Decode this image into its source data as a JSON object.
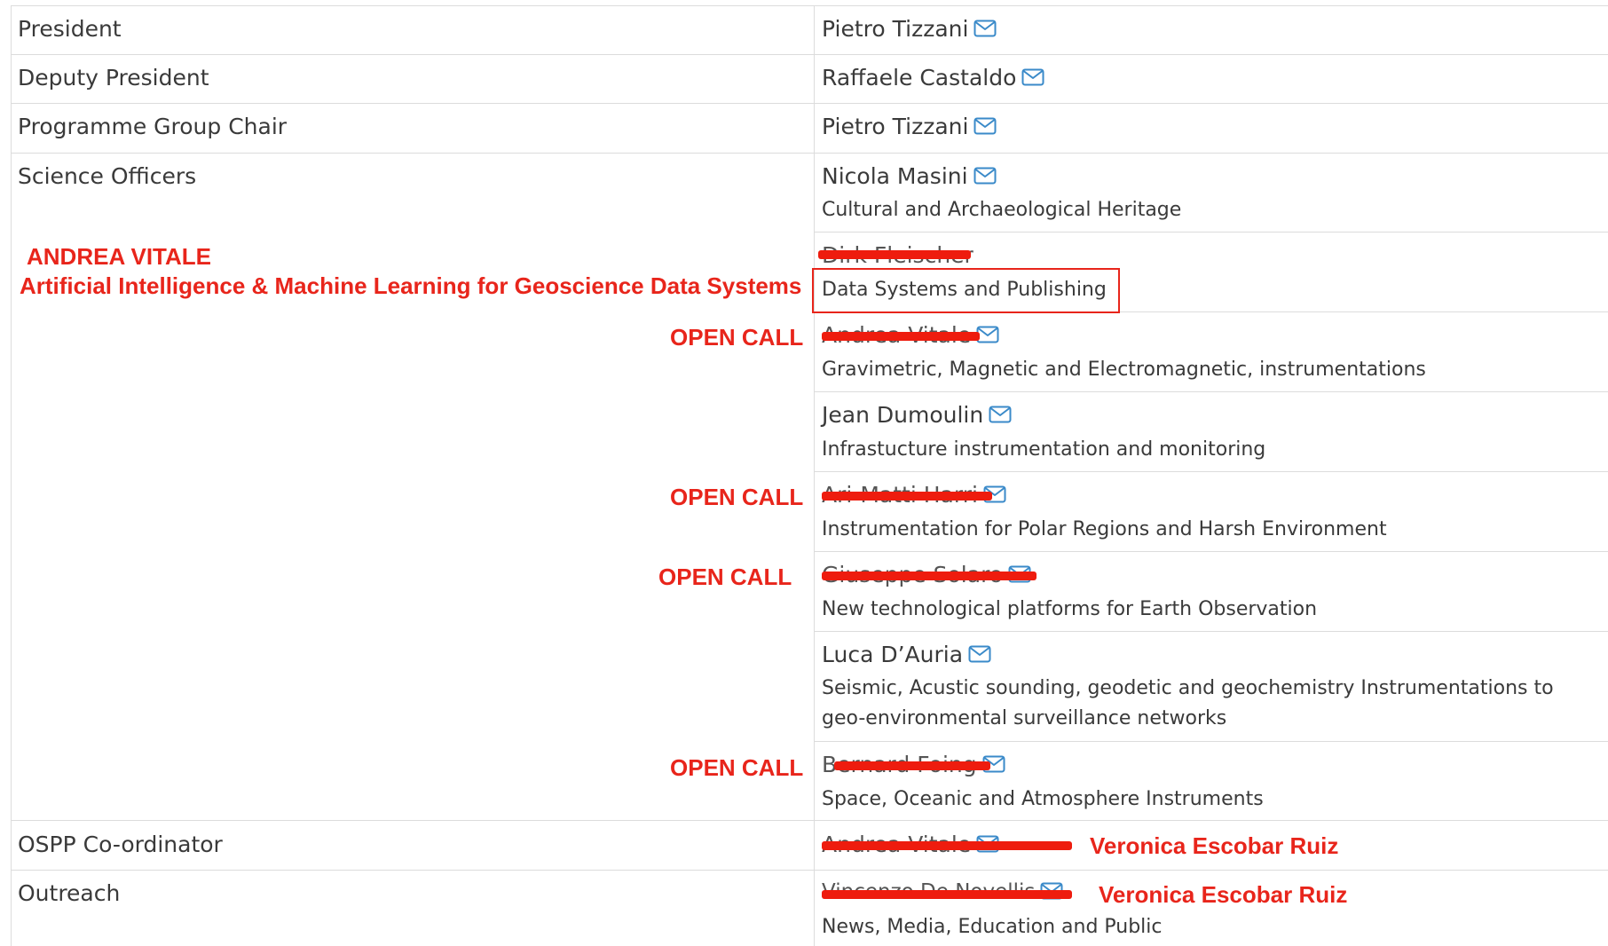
{
  "rows": {
    "president": {
      "role": "President",
      "person": "Pietro Tizzani"
    },
    "deputy": {
      "role": "Deputy President",
      "person": "Raffaele Castaldo"
    },
    "pg_chair": {
      "role": "Programme Group Chair",
      "person": "Pietro Tizzani"
    },
    "science": {
      "role": "Science Officers",
      "officers": [
        {
          "person": "Nicola Masini",
          "area": "Cultural and Archaeological Heritage"
        },
        {
          "person": "Dirk Fleischer",
          "area": "Data Systems and Publishing"
        },
        {
          "person": "Andrea Vitale",
          "area": "Gravimetric, Magnetic and Electromagnetic, instrumentations"
        },
        {
          "person": "Jean Dumoulin",
          "area": "Infrastucture instrumentation and monitoring"
        },
        {
          "person": "Ari-Matti Harri",
          "area": "Instrumentation for Polar Regions and Harsh Environment"
        },
        {
          "person": "Giuseppe Solaro",
          "area": "New technological platforms for Earth Observation"
        },
        {
          "person": "Luca D’Auria",
          "area": "Seismic, Acustic sounding, geodetic and geochemistry Instrumentations to geo-environmental surveillance networks"
        },
        {
          "person": "Bernard Foing",
          "area": "Space, Oceanic and Atmosphere Instruments"
        }
      ]
    },
    "ospp": {
      "role": "OSPP Co-ordinator",
      "person": "Andrea Vitale"
    },
    "outreach": {
      "role": "Outreach",
      "person": "Vincenzo De Novellis",
      "area": "News, Media, Education and Public"
    }
  },
  "annotations": {
    "name": "ANDREA VITALE",
    "topic": "Artificial Intelligence & Machine Learning for Geoscience Data Systems",
    "open_call_1": "OPEN CALL",
    "open_call_2": "OPEN CALL",
    "open_call_3": "OPEN CALL",
    "open_call_4": "OPEN CALL",
    "ospp_replacement": "Veronica Escobar Ruiz",
    "outreach_replacement": "Veronica Escobar Ruiz"
  },
  "colors": {
    "annotation_red": "#e8251b",
    "mail_icon": "#3a8ac9",
    "border": "#dcdcdc"
  }
}
